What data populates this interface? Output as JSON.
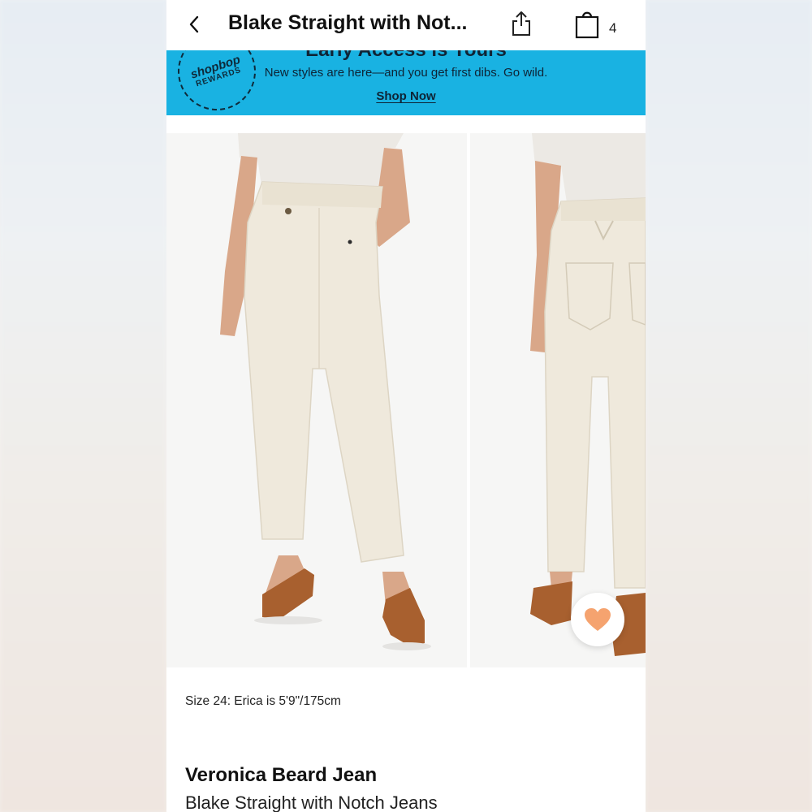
{
  "header": {
    "back_icon": "chevron-left-icon",
    "title": "Blake Straight with Not...",
    "share_icon": "share-icon",
    "bag_icon": "shopping-bag-icon",
    "bag_count": "4"
  },
  "banner": {
    "badge_brand": "shopbop",
    "badge_sub": "REWARDS",
    "heading": "Early Access is Yours",
    "subtext": "New styles are here—and you get first dibs. Go wild.",
    "link": "Shop Now",
    "color": "#19b2e2"
  },
  "gallery": {
    "images": [
      "front-view",
      "back-view"
    ],
    "favorite_icon": "heart-icon",
    "favorite_color": "#f5a36f"
  },
  "product": {
    "size_note": "Size 24: Erica is 5'9\"/175cm",
    "brand": "Veronica Beard Jean",
    "name": "Blake Straight with Notch Jeans"
  }
}
